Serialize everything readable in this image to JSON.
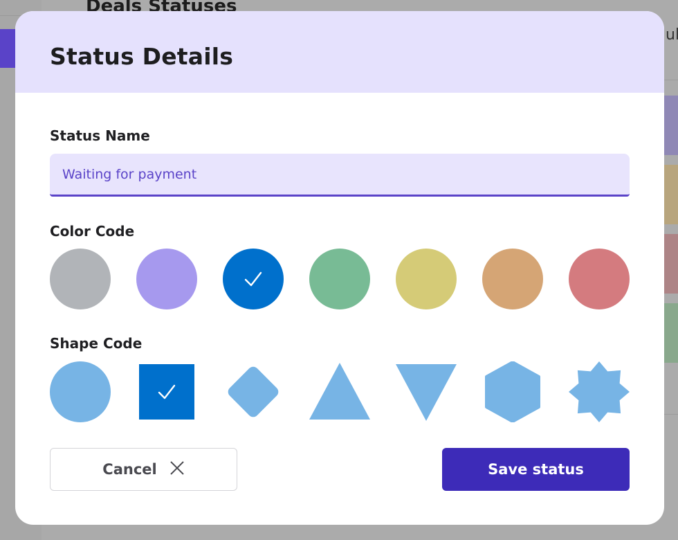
{
  "background": {
    "page_title": "Deals Statuses",
    "right_text": "ul"
  },
  "modal": {
    "title": "Status Details",
    "status_name": {
      "label": "Status Name",
      "value": "Waiting for payment"
    },
    "color_code": {
      "label": "Color Code",
      "options": [
        {
          "name": "gray",
          "hex": "#b1b4b8",
          "selected": false
        },
        {
          "name": "purple",
          "hex": "#a699ee",
          "selected": false
        },
        {
          "name": "blue",
          "hex": "#0070cc",
          "selected": true
        },
        {
          "name": "green",
          "hex": "#78bb95",
          "selected": false
        },
        {
          "name": "yellow",
          "hex": "#d5cb77",
          "selected": false
        },
        {
          "name": "orange",
          "hex": "#d5a575",
          "selected": false
        },
        {
          "name": "red",
          "hex": "#d47b7f",
          "selected": false
        }
      ]
    },
    "shape_code": {
      "label": "Shape Code",
      "shape_color": "#77b4e5",
      "selected_color": "#0070cc",
      "options": [
        {
          "name": "circle",
          "selected": false
        },
        {
          "name": "square",
          "selected": true
        },
        {
          "name": "diamond",
          "selected": false
        },
        {
          "name": "triangle-up",
          "selected": false
        },
        {
          "name": "triangle-down",
          "selected": false
        },
        {
          "name": "hexagon",
          "selected": false
        },
        {
          "name": "star-8",
          "selected": false
        }
      ]
    },
    "cancel_label": "Cancel",
    "save_label": "Save status"
  }
}
